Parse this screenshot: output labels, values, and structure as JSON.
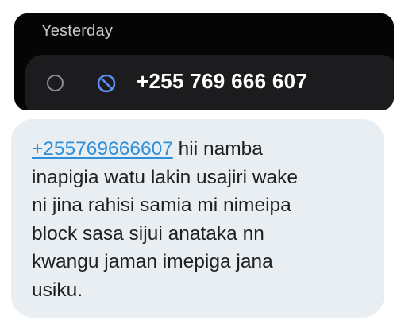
{
  "call_log": {
    "section_header": "Yesterday",
    "entries": [
      {
        "number": "+255 769 666 607",
        "status_icon": "blocked-icon",
        "select_icon": "radio-circle-icon"
      }
    ]
  },
  "message": {
    "link": "+255769666607",
    "line_1_rest": " hii namba",
    "line_2": "inapigia watu lakin usajiri wake",
    "line_3": "ni jina rahisi samia mi nimeipa",
    "line_4": "block sasa sijui anataka nn",
    "line_5": "kwangu jaman imepiga jana",
    "line_6": "usiku."
  },
  "colors": {
    "call_card_bg": "#050505",
    "call_row_bg": "#1c1c1e",
    "blocked_icon": "#5b8def",
    "bubble_bg": "#e9eef3",
    "link": "#2f8fd9"
  }
}
